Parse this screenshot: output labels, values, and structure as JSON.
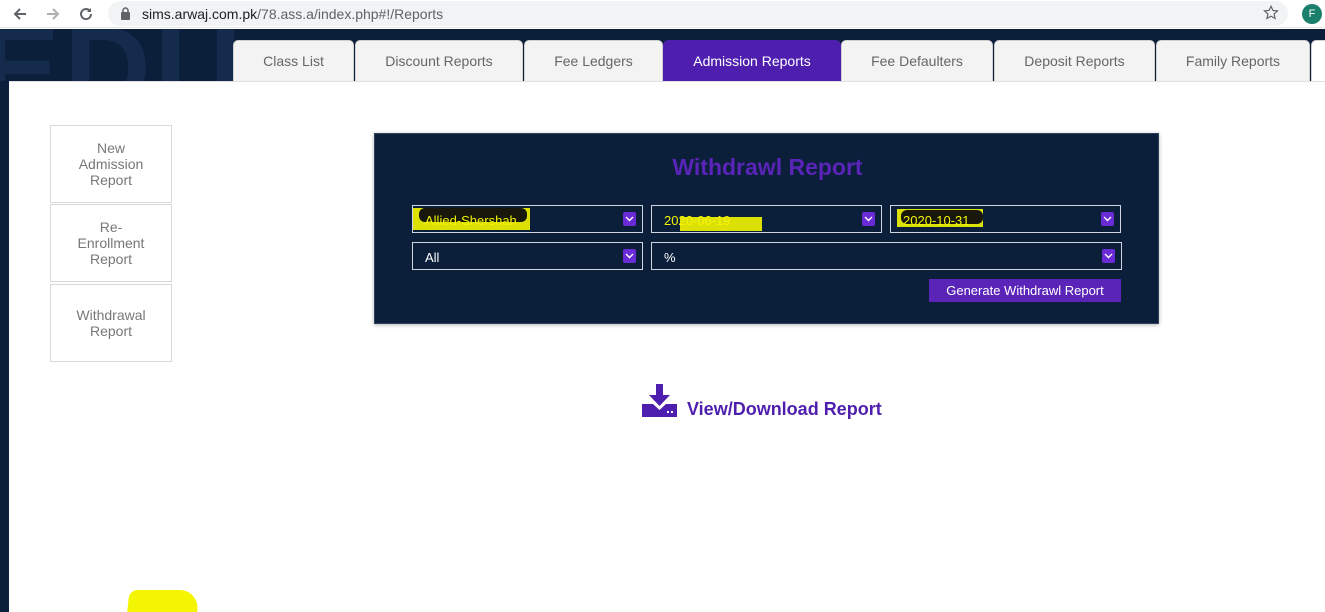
{
  "browser": {
    "url_host": "sims.arwaj.com.pk",
    "url_path": "/78.ass.a/index.php#!/Reports",
    "profile_initial": "F"
  },
  "tabs": [
    {
      "label": "Class List",
      "active": false
    },
    {
      "label": "Discount Reports",
      "active": false
    },
    {
      "label": "Fee Ledgers",
      "active": false
    },
    {
      "label": "Admission Reports",
      "active": true
    },
    {
      "label": "Fee Defaulters",
      "active": false
    },
    {
      "label": "Deposit Reports",
      "active": false
    },
    {
      "label": "Family Reports",
      "active": false
    }
  ],
  "sidebar": {
    "items": [
      {
        "line1": "New",
        "line2": "Admission",
        "line3": "Report"
      },
      {
        "line1": "Re-",
        "line2": "Enrollment",
        "line3": "Report"
      },
      {
        "line1": "Withdrawal",
        "line2": "Report",
        "line3": ""
      }
    ]
  },
  "report": {
    "title": "Withdrawl Report",
    "campus": "Allied-Shershah",
    "date_from": "2020-06-19",
    "date_to": "2020-10-31",
    "class": "All",
    "section": "%",
    "generate_label": "Generate Withdrawl Report"
  },
  "download": {
    "label": "View/Download Report"
  },
  "colors": {
    "accent": "#4e1fae",
    "header_bg": "#0b1f3a",
    "highlight": "#f4f500"
  }
}
